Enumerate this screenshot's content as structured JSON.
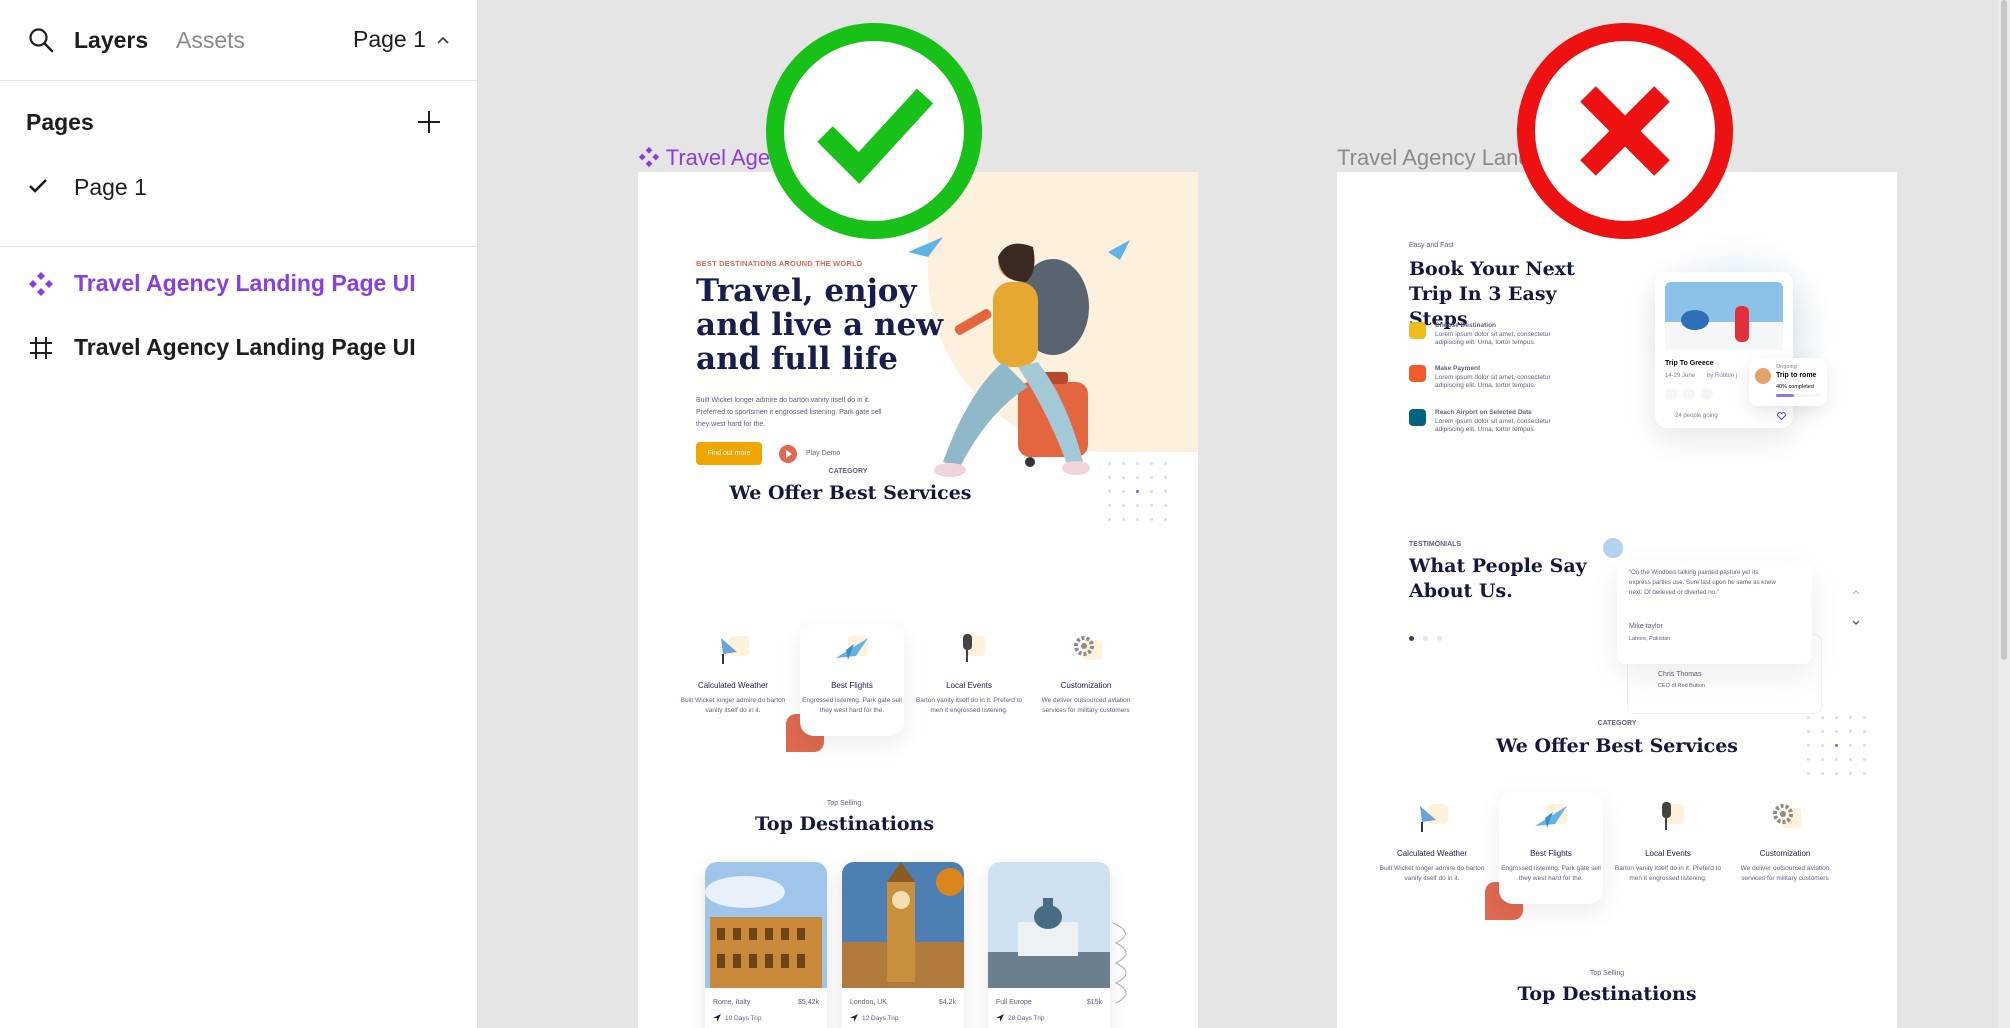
{
  "panel": {
    "tabs": {
      "layers": "Layers",
      "assets": "Assets"
    },
    "page_selector": "Page 1",
    "pages_heading": "Pages",
    "pages": [
      {
        "label": "Page 1",
        "selected": true
      }
    ],
    "layers": [
      {
        "label": "Travel Agency Landing Page UI",
        "type": "component",
        "icon": "component-icon"
      },
      {
        "label": "Travel Agency Landing Page UI",
        "type": "frame",
        "icon": "frame-icon"
      }
    ]
  },
  "canvas": {
    "frame_a": {
      "title": "Travel Agency Landing Page UI",
      "verdict": "correct",
      "hero": {
        "eyebrow": "BEST DESTINATIONS AROUND THE WORLD",
        "title": "Travel, enjoy and live a new and full life",
        "paragraph": "Built Wicket longer admire do barton vanity itself do in it. Preferred to sportsmen it engrossed listening. Park gate sell they west hard for the.",
        "cta": "Find out more",
        "play": "Play Demo"
      },
      "services": {
        "category": "CATEGORY",
        "heading": "We Offer Best Services",
        "items": [
          {
            "title": "Calculated Weather",
            "desc": "Built Wicket longer admire do barton vanity itself do in it."
          },
          {
            "title": "Best Flights",
            "desc": "Engrossed listening. Park gate sell they west hard for the."
          },
          {
            "title": "Local Events",
            "desc": "Barton vanity itself do in it. Preferd to men it engrossed listening."
          },
          {
            "title": "Customization",
            "desc": "We deliver outsourced aviation services for military customers"
          }
        ]
      },
      "destinations": {
        "eyebrow": "Top Selling",
        "heading": "Top Destinations",
        "items": [
          {
            "name": "Rome, Italty",
            "price": "$5,42k",
            "trip": "10 Days Trip"
          },
          {
            "name": "London, UK",
            "price": "$4.2k",
            "trip": "12 Days Trip"
          },
          {
            "name": "Full Europe",
            "price": "$15k",
            "trip": "28 Days Trip"
          }
        ]
      }
    },
    "frame_b": {
      "title": "Travel Agency Landing Page UI",
      "verdict": "wrong",
      "booking": {
        "eyebrow": "Easy and Fast",
        "heading": "Book Your Next Trip In 3 Easy Steps",
        "steps": [
          {
            "title": "Choose Destination",
            "desc": "Lorem ipsum dolor sit amet, consectetur adipiscing elit. Urna, tortor tempus.",
            "color": "#f0bb1f"
          },
          {
            "title": "Make Payment",
            "desc": "Lorem ipsum dolor sit amet, consectetur adipiscing elit. Urna, tortor tempus.",
            "color": "#f15a2b"
          },
          {
            "title": "Reach Airport on Selected Date",
            "desc": "Lorem ipsum dolor sit amet, consectetur adipiscing elit. Urna, tortor tempus.",
            "color": "#006380"
          }
        ],
        "trip_card": {
          "title": "Trip To Greece",
          "dates": "14-29 June",
          "by": "by Robbin j",
          "going": "24 people going",
          "ongoing_label": "Ongoing",
          "ongoing_title": "Trip to rome",
          "completion": "40% completed",
          "completion_value": 0.4
        }
      },
      "testimonials": {
        "eyebrow": "TESTIMONIALS",
        "heading": "What People Say About Us.",
        "quote": "“On the Windows talking painted pasture yet its express parties use. Sure last upon he same as knew next. Of believed or diverted no.”",
        "name": "Mike taylor",
        "location": "Lahore, Pakistan",
        "name2": "Chris Thomas",
        "role2": "CEO of Red Button"
      },
      "services": {
        "category": "CATEGORY",
        "heading": "We Offer Best Services",
        "items": [
          {
            "title": "Calculated Weather",
            "desc": "Built Wicket longer admire do barton vanity itself do in it."
          },
          {
            "title": "Best Flights",
            "desc": "Engrossed listening. Park gate sell they west hard for the."
          },
          {
            "title": "Local Events",
            "desc": "Barton vanity itself do in it. Preferd to men it engrossed listening."
          },
          {
            "title": "Customization",
            "desc": "We deliver outsourced aviation services for military customers"
          }
        ]
      },
      "destinations": {
        "eyebrow": "Top Selling",
        "heading": "Top Destinations"
      }
    }
  },
  "colors": {
    "component_purple": "#8a3ee0",
    "check_green": "#17c117",
    "cross_red": "#ee1111",
    "brand_orange": "#df6951",
    "brand_yellow": "#f1a501",
    "heading_navy": "#181e4b"
  }
}
